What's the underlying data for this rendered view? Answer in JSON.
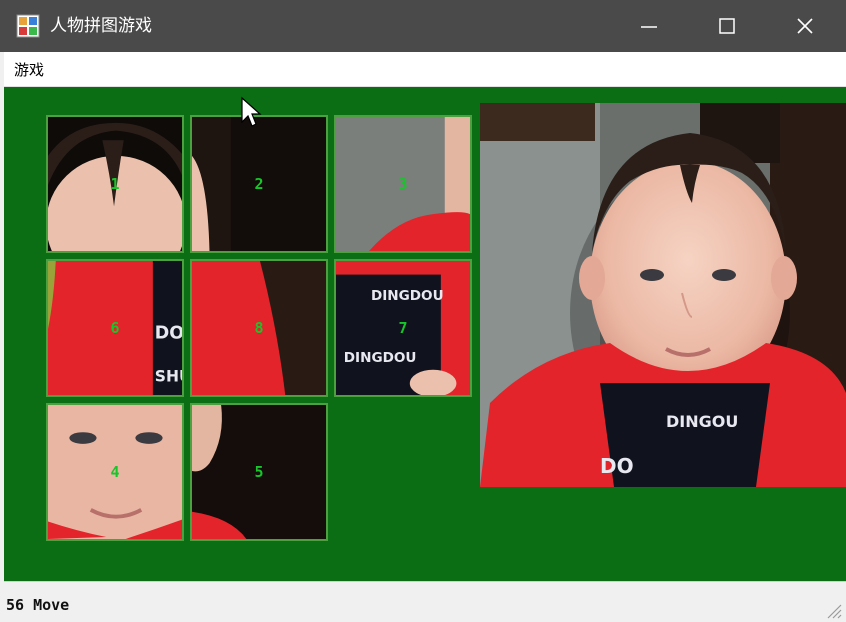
{
  "window": {
    "title": "人物拼图游戏"
  },
  "menu": {
    "items": [
      {
        "label": "游戏"
      }
    ]
  },
  "puzzle": {
    "grid_size": 3,
    "empty_slot": {
      "row": 2,
      "col": 2
    },
    "tiles": [
      {
        "number": "1",
        "piece": 1,
        "row": 0,
        "col": 0
      },
      {
        "number": "2",
        "piece": 2,
        "row": 0,
        "col": 1
      },
      {
        "number": "3",
        "piece": 3,
        "row": 0,
        "col": 2
      },
      {
        "number": "6",
        "piece": 6,
        "row": 1,
        "col": 0
      },
      {
        "number": "8",
        "piece": 8,
        "row": 1,
        "col": 1
      },
      {
        "number": "7",
        "piece": 7,
        "row": 1,
        "col": 2
      },
      {
        "number": "4",
        "piece": 4,
        "row": 2,
        "col": 0
      },
      {
        "number": "5",
        "piece": 5,
        "row": 2,
        "col": 1
      }
    ]
  },
  "status": {
    "text": "56 Move"
  },
  "colors": {
    "board": "#0b6d14",
    "tile_border": "#4da03f",
    "tile_number": "#18c52a",
    "titlebar": "#4a4a4a"
  }
}
